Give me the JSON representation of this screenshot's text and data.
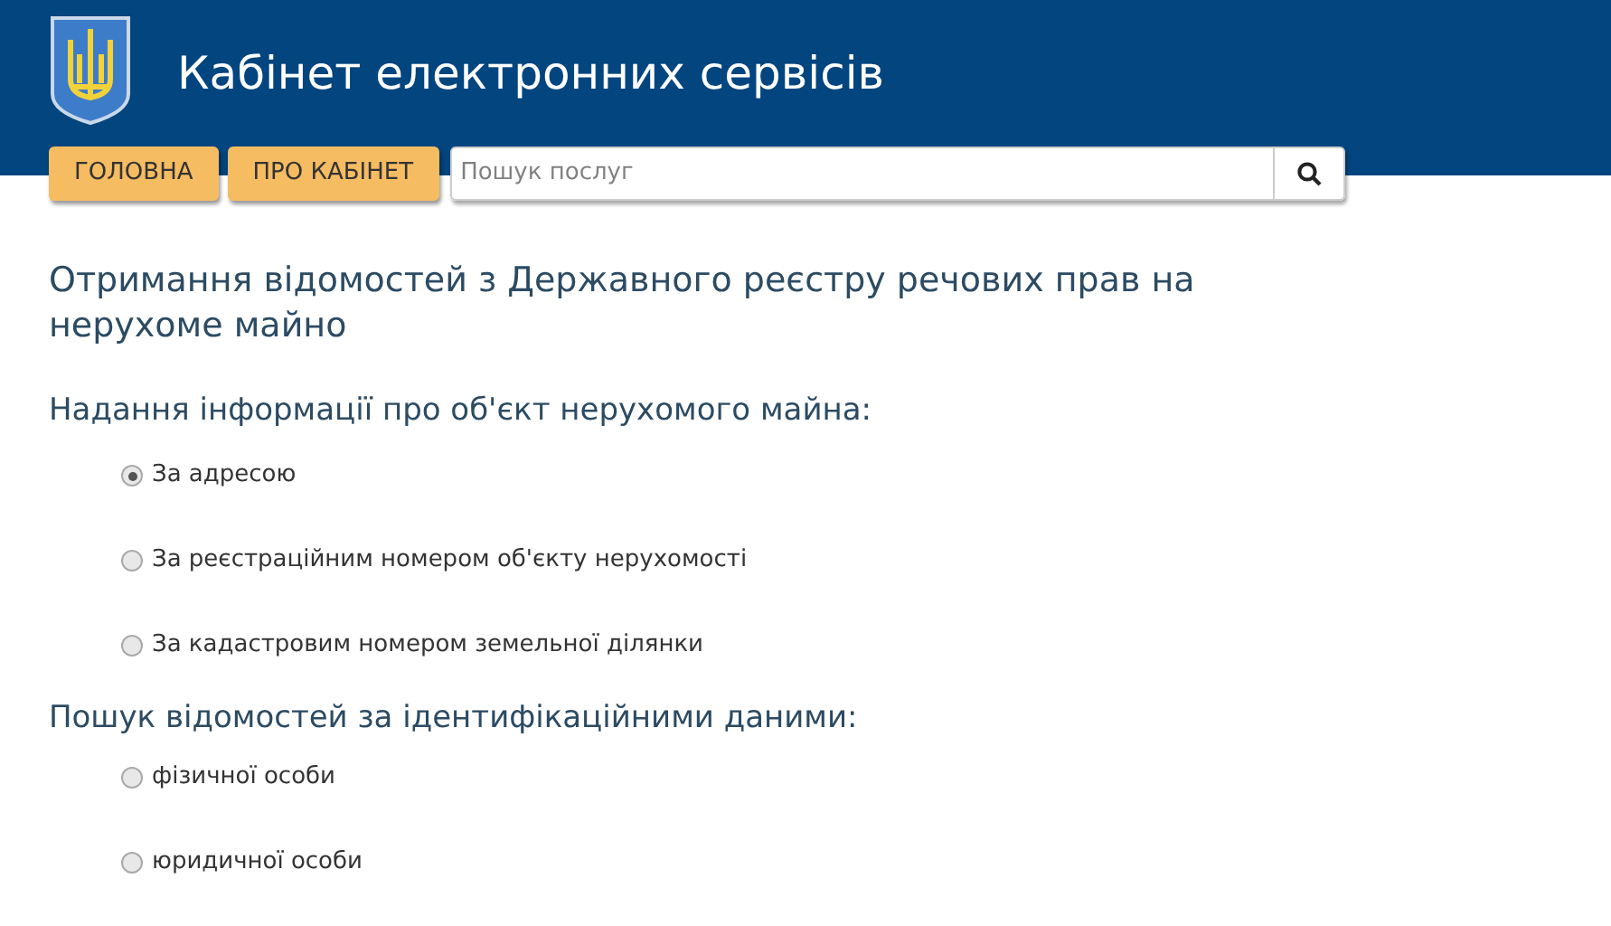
{
  "header": {
    "title": "Кабінет електронних сервісів"
  },
  "nav": {
    "buttons": [
      "ГОЛОВНА",
      "ПРО КАБІНЕТ"
    ],
    "search": {
      "placeholder": "Пошук послуг"
    }
  },
  "page_title": "Отримання відомостей з Державного реєстру речових прав на нерухоме майно",
  "sections": [
    {
      "heading": "Надання інформації про об'єкт нерухомого майна:",
      "options": [
        {
          "label": "За адресою",
          "selected": true
        },
        {
          "label": "За реєстраційним номером об'єкту нерухомості",
          "selected": false
        },
        {
          "label": "За кадастровим номером земельної ділянки",
          "selected": false
        }
      ]
    },
    {
      "heading": "Пошук відомостей за ідентифікаційними даними:",
      "options": [
        {
          "label": "фізичної особи",
          "selected": false
        },
        {
          "label": "юридичної особи",
          "selected": false
        }
      ]
    }
  ]
}
